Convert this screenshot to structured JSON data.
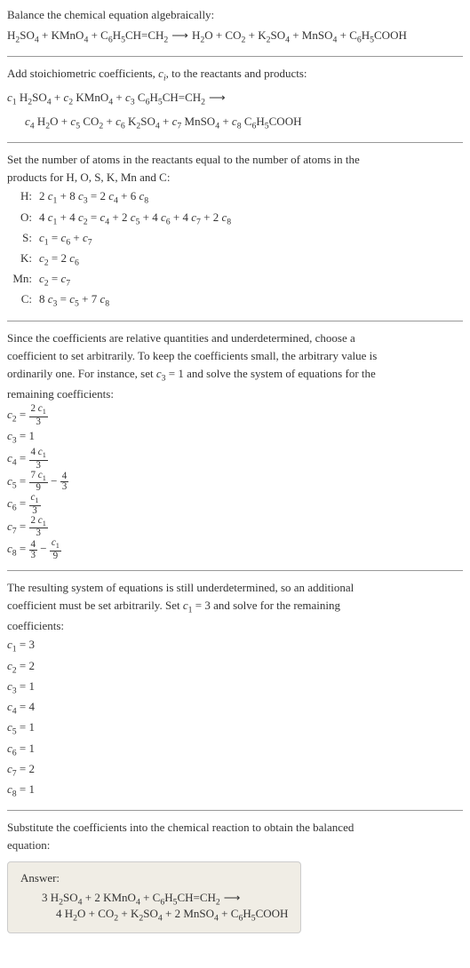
{
  "intro": {
    "line1": "Balance the chemical equation algebraically:",
    "eq": "H₂SO₄ + KMnO₄ + C₆H₅CH=CH₂ ⟶ H₂O + CO₂ + K₂SO₄ + MnSO₄ + C₆H₅COOH"
  },
  "stoich": {
    "line1": "Add stoichiometric coefficients, cᵢ, to the reactants and products:",
    "eq1": "c₁ H₂SO₄ + c₂ KMnO₄ + c₃ C₆H₅CH=CH₂ ⟶",
    "eq2": "c₄ H₂O + c₅ CO₂ + c₆ K₂SO₄ + c₇ MnSO₄ + c₈ C₆H₅COOH"
  },
  "atoms": {
    "intro1": "Set the number of atoms in the reactants equal to the number of atoms in the",
    "intro2": "products for H, O, S, K, Mn and C:",
    "rows": [
      {
        "label": "H:",
        "eq": "2 c₁ + 8 c₃ = 2 c₄ + 6 c₈"
      },
      {
        "label": "O:",
        "eq": "4 c₁ + 4 c₂ = c₄ + 2 c₅ + 4 c₆ + 4 c₇ + 2 c₈"
      },
      {
        "label": "S:",
        "eq": "c₁ = c₆ + c₇"
      },
      {
        "label": "K:",
        "eq": "c₂ = 2 c₆"
      },
      {
        "label": "Mn:",
        "eq": "c₂ = c₇"
      },
      {
        "label": "C:",
        "eq": "8 c₃ = c₅ + 7 c₈"
      }
    ]
  },
  "underdet1": {
    "line1": "Since the coefficients are relative quantities and underdetermined, choose a",
    "line2": "coefficient to set arbitrarily. To keep the coefficients small, the arbitrary value is",
    "line3": "ordinarily one. For instance, set c₃ = 1 and solve the system of equations for the",
    "line4": "remaining coefficients:",
    "coefs": [
      {
        "lhs": "c₂ =",
        "type": "frac",
        "num": "2 c₁",
        "den": "3"
      },
      {
        "lhs": "c₃ =",
        "type": "plain",
        "val": "1"
      },
      {
        "lhs": "c₄ =",
        "type": "frac",
        "num": "4 c₁",
        "den": "3"
      },
      {
        "lhs": "c₅ =",
        "type": "fracminus",
        "num1": "7 c₁",
        "den1": "9",
        "num2": "4",
        "den2": "3"
      },
      {
        "lhs": "c₆ =",
        "type": "frac",
        "num": "c₁",
        "den": "3"
      },
      {
        "lhs": "c₇ =",
        "type": "frac",
        "num": "2 c₁",
        "den": "3"
      },
      {
        "lhs": "c₈ =",
        "type": "fracminus2",
        "num1": "4",
        "den1": "3",
        "num2": "c₁",
        "den2": "9"
      }
    ]
  },
  "underdet2": {
    "line1": "The resulting system of equations is still underdetermined, so an additional",
    "line2": "coefficient must be set arbitrarily. Set c₁ = 3 and solve for the remaining",
    "line3": "coefficients:",
    "coefs": [
      "c₁ = 3",
      "c₂ = 2",
      "c₃ = 1",
      "c₄ = 4",
      "c₅ = 1",
      "c₆ = 1",
      "c₇ = 2",
      "c₈ = 1"
    ]
  },
  "final": {
    "line1": "Substitute the coefficients into the chemical reaction to obtain the balanced",
    "line2": "equation:",
    "answer_label": "Answer:",
    "answer_eq1": "3 H₂SO₄ + 2 KMnO₄ + C₆H₅CH=CH₂ ⟶",
    "answer_eq2": "4 H₂O + CO₂ + K₂SO₄ + 2 MnSO₄ + C₆H₅COOH"
  }
}
